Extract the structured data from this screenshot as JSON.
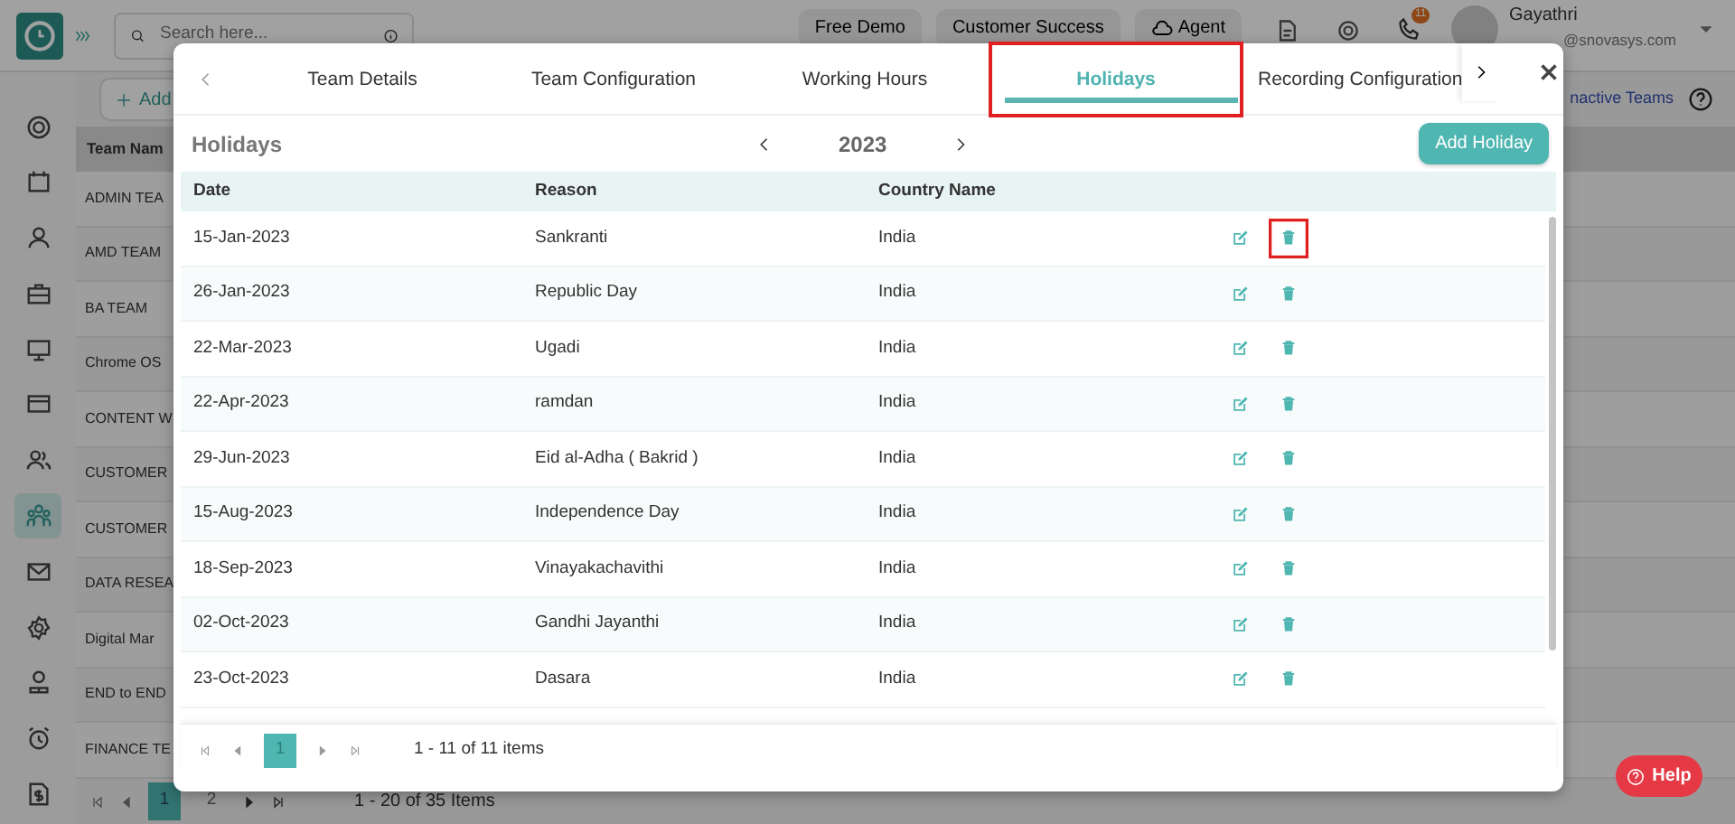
{
  "app": {
    "search": {
      "placeholder": "Search here..."
    },
    "header_buttons": [
      "Free Demo",
      "Customer Success",
      "Agent"
    ],
    "notification_count": "11",
    "user": {
      "name": "Gayathri",
      "email": "@snovasys.com"
    },
    "sidebar": {
      "items": [
        {
          "selected": false
        },
        {
          "selected": false
        },
        {
          "selected": false
        },
        {
          "selected": false
        },
        {
          "selected": false
        },
        {
          "selected": false
        },
        {
          "selected": false
        },
        {
          "selected": true
        },
        {
          "selected": false
        },
        {
          "selected": false
        },
        {
          "selected": false
        },
        {
          "selected": false
        },
        {
          "selected": false
        }
      ]
    },
    "add_button": "Add",
    "inactive_link": "nactive Teams",
    "team_column": "Team Nam",
    "teams": [
      "ADMIN TEA",
      "AMD TEAM",
      "BA TEAM",
      "Chrome OS",
      "CONTENT W",
      "CUSTOMER",
      "CUSTOMER",
      "DATA RESEA",
      "Digital Mar",
      "END to END",
      "FINANCE TE"
    ],
    "pager": {
      "pages": [
        {
          "label": "1",
          "selected": true
        },
        {
          "label": "2",
          "selected": false
        }
      ],
      "summary": "1 - 20 of 35 Items"
    }
  },
  "modal": {
    "tabs": [
      {
        "label": "Team Details",
        "selected": false,
        "annotated": false
      },
      {
        "label": "Team Configuration",
        "selected": false,
        "annotated": false
      },
      {
        "label": "Working Hours",
        "selected": false,
        "annotated": false
      },
      {
        "label": "Holidays",
        "selected": true,
        "annotated": true
      },
      {
        "label": "Recording Configuration",
        "selected": false,
        "annotated": false
      }
    ],
    "title": "Holidays",
    "year": "2023",
    "add_button": "Add Holiday",
    "columns": [
      "Date",
      "Reason",
      "Country Name"
    ],
    "rows": [
      {
        "date": "15-Jan-2023",
        "reason": "Sankranti",
        "country": "India",
        "delete_annotated": true
      },
      {
        "date": "26-Jan-2023",
        "reason": "Republic Day",
        "country": "India",
        "delete_annotated": false
      },
      {
        "date": "22-Mar-2023",
        "reason": "Ugadi",
        "country": "India",
        "delete_annotated": false
      },
      {
        "date": "22-Apr-2023",
        "reason": "ramdan",
        "country": "India",
        "delete_annotated": false
      },
      {
        "date": "29-Jun-2023",
        "reason": "Eid al-Adha ( Bakrid )",
        "country": "India",
        "delete_annotated": false
      },
      {
        "date": "15-Aug-2023",
        "reason": "Independence Day",
        "country": "India",
        "delete_annotated": false
      },
      {
        "date": "18-Sep-2023",
        "reason": "Vinayakachavithi",
        "country": "India",
        "delete_annotated": false
      },
      {
        "date": "02-Oct-2023",
        "reason": "Gandhi Jayanthi",
        "country": "India",
        "delete_annotated": false
      },
      {
        "date": "23-Oct-2023",
        "reason": "Dasara",
        "country": "India",
        "delete_annotated": false
      }
    ],
    "pager": {
      "pages": [
        {
          "label": "1",
          "selected": true
        }
      ],
      "summary": "1 - 11 of 11 items"
    }
  },
  "help_button": "Help"
}
